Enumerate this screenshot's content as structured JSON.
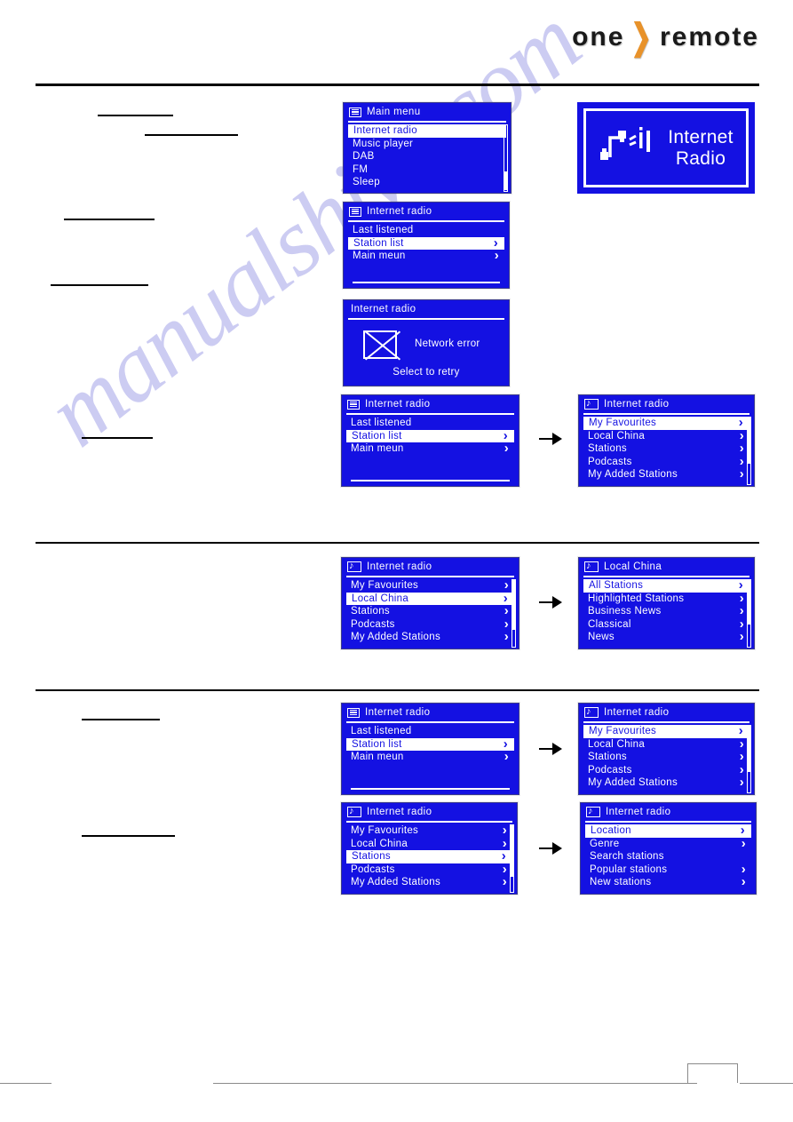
{
  "brand": {
    "name_left": "one",
    "chevron": "❯",
    "name_right": "remote"
  },
  "watermark": {
    "text": "manualshive.com"
  },
  "screens": {
    "main_menu": {
      "title": "Main  menu",
      "icon": "menu-list-icon",
      "items": [
        {
          "label": "Internet  radio",
          "selected": true,
          "chevron": ""
        },
        {
          "label": "Music  player",
          "selected": false,
          "chevron": ""
        },
        {
          "label": "DAB",
          "selected": false,
          "chevron": ""
        },
        {
          "label": "FM",
          "selected": false,
          "chevron": ""
        },
        {
          "label": "Sleep",
          "selected": false,
          "chevron": ""
        }
      ]
    },
    "internet_radio_menu": {
      "title": "Internet  radio",
      "icon": "menu-list-icon",
      "items": [
        {
          "label": "Last  listened",
          "selected": false,
          "chevron": ""
        },
        {
          "label": "Station  list",
          "selected": true,
          "chevron": "›"
        },
        {
          "label": "Main  meun",
          "selected": false,
          "chevron": "›"
        }
      ]
    },
    "network_error": {
      "title": "Internet  radio",
      "icon": "crossed-box-icon",
      "message": "Network  error",
      "hint": "Select  to  retry"
    },
    "station_list": {
      "title": "Internet  radio",
      "icon": "music-note-icon",
      "items": [
        {
          "label": "My  Favourites",
          "selected": true,
          "chevron": "›"
        },
        {
          "label": "Local  China",
          "selected": false,
          "chevron": "›"
        },
        {
          "label": "Stations",
          "selected": false,
          "chevron": "›"
        },
        {
          "label": "Podcasts",
          "selected": false,
          "chevron": "›"
        },
        {
          "label": "My  Added  Stations",
          "selected": false,
          "chevron": "›"
        }
      ]
    },
    "station_list_local_sel": {
      "title": "Internet  radio",
      "icon": "music-note-icon",
      "items": [
        {
          "label": "My  Favourites",
          "selected": false,
          "chevron": "›"
        },
        {
          "label": "Local  China",
          "selected": true,
          "chevron": "›"
        },
        {
          "label": "Stations",
          "selected": false,
          "chevron": "›"
        },
        {
          "label": "Podcasts",
          "selected": false,
          "chevron": "›"
        },
        {
          "label": "My  Added  Stations",
          "selected": false,
          "chevron": "›"
        }
      ]
    },
    "local_china": {
      "title": "Local  China",
      "icon": "music-note-icon",
      "items": [
        {
          "label": "All  Stations",
          "selected": true,
          "chevron": "›"
        },
        {
          "label": "Highlighted  Stations",
          "selected": false,
          "chevron": "›"
        },
        {
          "label": "Business  News",
          "selected": false,
          "chevron": "›"
        },
        {
          "label": "Classical",
          "selected": false,
          "chevron": "›"
        },
        {
          "label": "News",
          "selected": false,
          "chevron": "›"
        }
      ]
    },
    "station_list_stations_sel": {
      "title": "Internet  radio",
      "icon": "music-note-icon",
      "items": [
        {
          "label": "My  Favourites",
          "selected": false,
          "chevron": "›"
        },
        {
          "label": "Local  China",
          "selected": false,
          "chevron": "›"
        },
        {
          "label": "Stations",
          "selected": true,
          "chevron": "›"
        },
        {
          "label": "Podcasts",
          "selected": false,
          "chevron": "›"
        },
        {
          "label": "My  Added  Stations",
          "selected": false,
          "chevron": "›"
        }
      ]
    },
    "stations_submenu": {
      "title": "Internet  radio",
      "icon": "music-note-icon",
      "items": [
        {
          "label": "Location",
          "selected": true,
          "chevron": "›"
        },
        {
          "label": "Genre",
          "selected": false,
          "chevron": "›"
        },
        {
          "label": "Search  stations",
          "selected": false,
          "chevron": ""
        },
        {
          "label": "Popular  stations",
          "selected": false,
          "chevron": "›"
        },
        {
          "label": "New  stations",
          "selected": false,
          "chevron": "›"
        }
      ]
    },
    "splash": {
      "glyph": "⚬♪⚬»ıȷ",
      "line1": "Internet",
      "line2": "Radio"
    }
  },
  "colors": {
    "lcd_background": "#1411E2",
    "lcd_foreground": "#FFFFFF",
    "brand_accent": "#E8922A",
    "watermark": "#CCCCF2",
    "rule": "#000000",
    "footer_rule": "#8A8A8A"
  }
}
